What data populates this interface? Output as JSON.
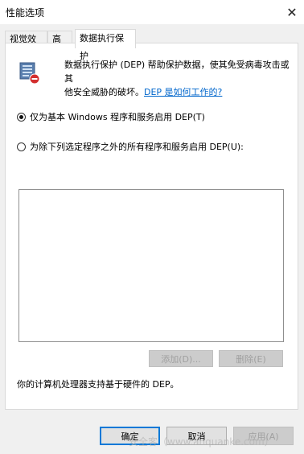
{
  "window": {
    "title": "性能选项",
    "close_glyph": "✕"
  },
  "tabs": [
    {
      "label": "视觉效果",
      "active": false
    },
    {
      "label": "高级",
      "active": false
    },
    {
      "label": "数据执行保护",
      "active": true
    }
  ],
  "dep": {
    "description_line1": "数据执行保护 (DEP) 帮助保护数据，使其免受病毒攻击或其",
    "description_line2_prefix": "他安全威胁的破坏。",
    "link_text": "DEP 是如何工作的?",
    "option_essential": "仅为基本 Windows 程序和服务启用 DEP(T)",
    "option_all_except": "为除下列选定程序之外的所有程序和服务启用 DEP(U):",
    "selected_option": "essential",
    "add_button": "添加(D)...",
    "remove_button": "删除(E)",
    "hardware_support_text": "你的计算机处理器支持基于硬件的 DEP。"
  },
  "buttons": {
    "ok": "确定",
    "cancel": "取消",
    "apply": "应用(A)"
  },
  "watermark": "安全客（www.anquanke.com）",
  "icons": {
    "dep_icon": "shield-doc-icon",
    "close": "close-icon"
  },
  "colors": {
    "link": "#0066cc",
    "default_button_border": "#0078d7",
    "dialog_background": "#f0f0f0"
  }
}
